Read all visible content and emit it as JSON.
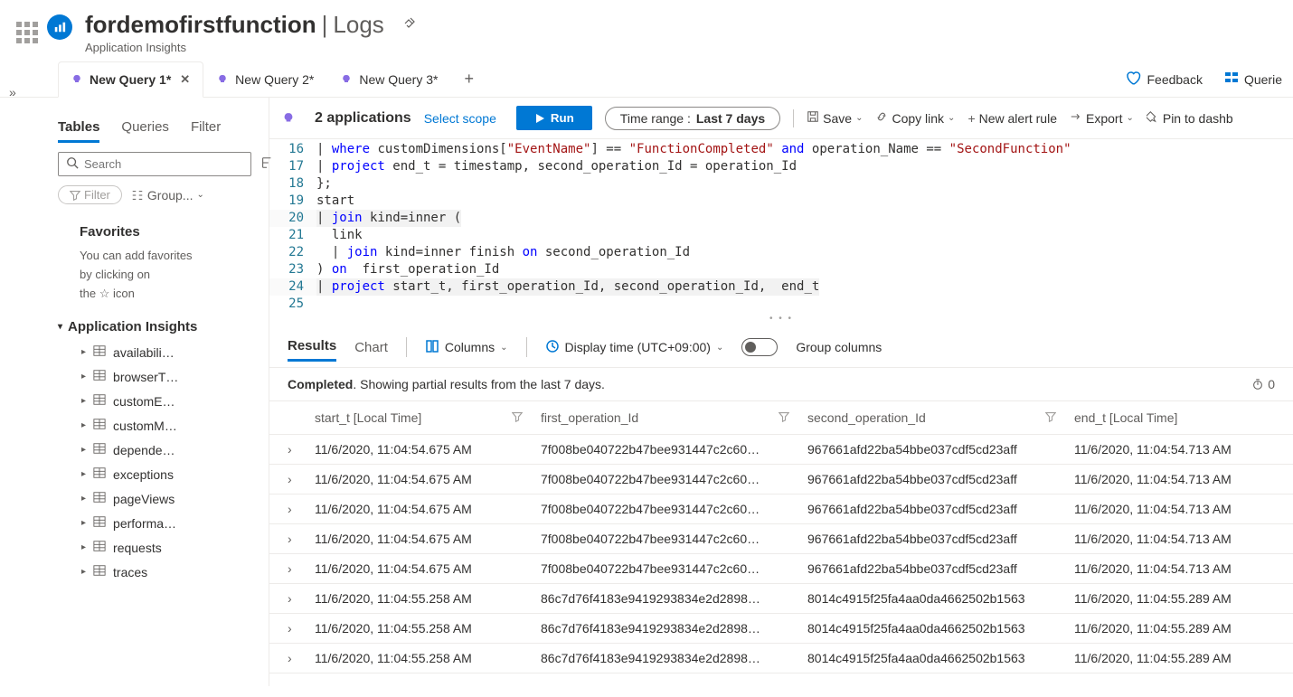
{
  "header": {
    "title": "fordemofirstfunction",
    "page": "Logs",
    "subtitle": "Application Insights"
  },
  "tabs": [
    {
      "label": "New Query 1*",
      "active": true
    },
    {
      "label": "New Query 2*",
      "active": false
    },
    {
      "label": "New Query 3*",
      "active": false
    }
  ],
  "topActions": {
    "feedback": "Feedback",
    "queries": "Querie"
  },
  "toolbar": {
    "apps": "2 applications",
    "selectScope": "Select scope",
    "run": "Run",
    "timeRangeLabel": "Time range :",
    "timeRangeValue": "Last 7 days",
    "save": "Save",
    "copyLink": "Copy link",
    "newAlert": "New alert rule",
    "export": "Export",
    "pin": "Pin to dashb"
  },
  "sidebar": {
    "tabs": {
      "tables": "Tables",
      "queries": "Queries",
      "filter": "Filter"
    },
    "searchPlaceholder": "Search",
    "filterPill": "Filter",
    "groupBy": "Group...",
    "favoritesTitle": "Favorites",
    "favoritesText1": "You can add favorites",
    "favoritesText2": "by clicking on",
    "favoritesText3": "the",
    "favoritesText4": "icon",
    "treeRoot": "Application Insights",
    "items": [
      "availabili…",
      "browserT…",
      "customE…",
      "customM…",
      "depende…",
      "exceptions",
      "pageViews",
      "performa…",
      "requests",
      "traces"
    ]
  },
  "editor": {
    "startLine": 16,
    "lines": [
      {
        "n": 16,
        "tokens": [
          {
            "t": "| ",
            "c": ""
          },
          {
            "t": "where",
            "c": "kw"
          },
          {
            "t": " customDimensions[",
            "c": ""
          },
          {
            "t": "\"EventName\"",
            "c": "str"
          },
          {
            "t": "] == ",
            "c": ""
          },
          {
            "t": "\"FunctionCompleted\"",
            "c": "str"
          },
          {
            "t": " ",
            "c": ""
          },
          {
            "t": "and",
            "c": "kw"
          },
          {
            "t": " operation_Name == ",
            "c": ""
          },
          {
            "t": "\"SecondFunction\"",
            "c": "str"
          }
        ]
      },
      {
        "n": 17,
        "tokens": [
          {
            "t": "| ",
            "c": ""
          },
          {
            "t": "project",
            "c": "kw"
          },
          {
            "t": " end_t = timestamp, second_operation_Id = operation_Id",
            "c": ""
          }
        ]
      },
      {
        "n": 18,
        "tokens": [
          {
            "t": "};",
            "c": ""
          }
        ]
      },
      {
        "n": 19,
        "tokens": [
          {
            "t": "start",
            "c": ""
          }
        ]
      },
      {
        "n": 20,
        "active": true,
        "tokens": [
          {
            "t": "| ",
            "c": ""
          },
          {
            "t": "join",
            "c": "kw"
          },
          {
            "t": " kind=inner (",
            "c": ""
          }
        ]
      },
      {
        "n": 21,
        "tokens": [
          {
            "t": "  link",
            "c": ""
          }
        ]
      },
      {
        "n": 22,
        "tokens": [
          {
            "t": "  | ",
            "c": ""
          },
          {
            "t": "join",
            "c": "kw"
          },
          {
            "t": " kind=inner finish ",
            "c": ""
          },
          {
            "t": "on",
            "c": "kw"
          },
          {
            "t": " second_operation_Id",
            "c": ""
          }
        ]
      },
      {
        "n": 23,
        "tokens": [
          {
            "t": ") ",
            "c": ""
          },
          {
            "t": "on",
            "c": "kw"
          },
          {
            "t": "  first_operation_Id",
            "c": ""
          }
        ]
      },
      {
        "n": 24,
        "active": true,
        "tokens": [
          {
            "t": "| ",
            "c": ""
          },
          {
            "t": "project",
            "c": "kw"
          },
          {
            "t": " start_t, first_operation_Id, second_operation_Id,  end_t",
            "c": ""
          }
        ]
      },
      {
        "n": 25,
        "tokens": [
          {
            "t": "",
            "c": ""
          }
        ]
      }
    ]
  },
  "resultsBar": {
    "results": "Results",
    "chart": "Chart",
    "columns": "Columns",
    "displayTime": "Display time (UTC+09:00)",
    "groupColumns": "Group columns"
  },
  "status": {
    "completed": "Completed",
    "rest": ". Showing partial results from the last 7 days.",
    "timer": "0"
  },
  "grid": {
    "headers": [
      "start_t [Local Time]",
      "first_operation_Id",
      "second_operation_Id",
      "end_t [Local Time]"
    ],
    "rows": [
      {
        "start_t": "11/6/2020, 11:04:54.675 AM",
        "first": "7f008be040722b47bee931447c2c60…",
        "second": "967661afd22ba54bbe037cdf5cd23aff",
        "end_t": "11/6/2020, 11:04:54.713 AM"
      },
      {
        "start_t": "11/6/2020, 11:04:54.675 AM",
        "first": "7f008be040722b47bee931447c2c60…",
        "second": "967661afd22ba54bbe037cdf5cd23aff",
        "end_t": "11/6/2020, 11:04:54.713 AM"
      },
      {
        "start_t": "11/6/2020, 11:04:54.675 AM",
        "first": "7f008be040722b47bee931447c2c60…",
        "second": "967661afd22ba54bbe037cdf5cd23aff",
        "end_t": "11/6/2020, 11:04:54.713 AM"
      },
      {
        "start_t": "11/6/2020, 11:04:54.675 AM",
        "first": "7f008be040722b47bee931447c2c60…",
        "second": "967661afd22ba54bbe037cdf5cd23aff",
        "end_t": "11/6/2020, 11:04:54.713 AM"
      },
      {
        "start_t": "11/6/2020, 11:04:54.675 AM",
        "first": "7f008be040722b47bee931447c2c60…",
        "second": "967661afd22ba54bbe037cdf5cd23aff",
        "end_t": "11/6/2020, 11:04:54.713 AM"
      },
      {
        "start_t": "11/6/2020, 11:04:55.258 AM",
        "first": "86c7d76f4183e9419293834e2d2898…",
        "second": "8014c4915f25fa4aa0da4662502b1563",
        "end_t": "11/6/2020, 11:04:55.289 AM"
      },
      {
        "start_t": "11/6/2020, 11:04:55.258 AM",
        "first": "86c7d76f4183e9419293834e2d2898…",
        "second": "8014c4915f25fa4aa0da4662502b1563",
        "end_t": "11/6/2020, 11:04:55.289 AM"
      },
      {
        "start_t": "11/6/2020, 11:04:55.258 AM",
        "first": "86c7d76f4183e9419293834e2d2898…",
        "second": "8014c4915f25fa4aa0da4662502b1563",
        "end_t": "11/6/2020, 11:04:55.289 AM"
      }
    ]
  }
}
